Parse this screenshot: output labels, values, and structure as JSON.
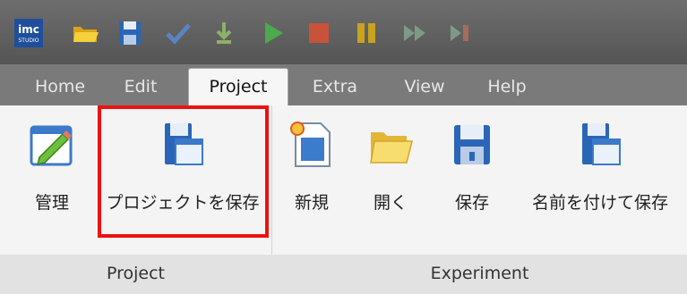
{
  "quick_access": {
    "app_logo_text": "imc",
    "app_logo_sub": "STUDIO",
    "icons": [
      "imc-logo-icon",
      "open-folder-icon",
      "save-icon",
      "check-icon",
      "download-icon",
      "play-icon",
      "stop-icon",
      "pause-icon",
      "fast-forward-icon",
      "step-icon"
    ]
  },
  "tabs": [
    {
      "label": "Home",
      "active": false
    },
    {
      "label": "Edit",
      "active": false
    },
    {
      "label": "Project",
      "active": true
    },
    {
      "label": "Extra",
      "active": false
    },
    {
      "label": "View",
      "active": false
    },
    {
      "label": "Help",
      "active": false
    }
  ],
  "ribbon": {
    "groups": [
      {
        "label": "Project"
      },
      {
        "label": "Experiment"
      }
    ],
    "buttons": [
      {
        "label": "管理",
        "icon": "manage-pencil-icon"
      },
      {
        "label": "プロジェクトを保存",
        "icon": "save-project-icon"
      },
      {
        "label": "新規",
        "icon": "new-document-icon"
      },
      {
        "label": "開く",
        "icon": "open-folder-icon"
      },
      {
        "label": "保存",
        "icon": "save-icon"
      },
      {
        "label": "名前を付けて保存",
        "icon": "save-as-icon"
      }
    ]
  },
  "colors": {
    "toolbar_bg": "#5f5f5f",
    "tabstrip_bg": "#7a7a7a",
    "highlight": "#ee1111"
  }
}
